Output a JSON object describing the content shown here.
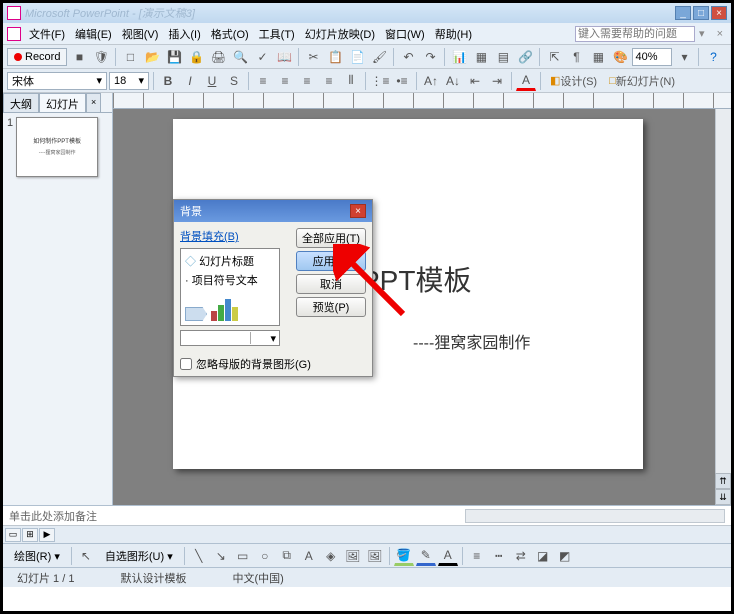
{
  "titlebar": {
    "title": "Microsoft PowerPoint - [演示文稿3]"
  },
  "menu": {
    "file": "文件(F)",
    "edit": "编辑(E)",
    "view": "视图(V)",
    "insert": "插入(I)",
    "format": "格式(O)",
    "tools": "工具(T)",
    "slideshow": "幻灯片放映(D)",
    "window": "窗口(W)",
    "help": "帮助(H)",
    "help_input": "键入需要帮助的问题"
  },
  "toolbar": {
    "record": "Record",
    "zoom": "40%"
  },
  "format": {
    "font": "宋体",
    "size": "18",
    "design": "设计(S)",
    "newslide": "新幻灯片(N)"
  },
  "tabs": {
    "outline": "大纲",
    "slides": "幻灯片"
  },
  "thumb": {
    "num": "1",
    "title": "如何制作PPT模板",
    "sub": "----狸窝家园制作"
  },
  "slide": {
    "title": "作PPT模板",
    "sub": "----狸窝家园制作"
  },
  "dialog": {
    "title": "背景",
    "link": "背景填充(B)",
    "pv1": "幻灯片标题",
    "pv2": "· 项目符号文本",
    "apply_all": "全部应用(T)",
    "apply": "应用(A)",
    "cancel": "取消",
    "preview": "预览(P)",
    "omit": "忽略母版的背景图形(G)"
  },
  "notes": {
    "placeholder": "单击此处添加备注"
  },
  "drawbar": {
    "draw": "绘图(R)",
    "autoshape": "自选图形(U)"
  },
  "status": {
    "slide": "幻灯片 1 / 1",
    "template": "默认设计模板",
    "lang": "中文(中国)"
  }
}
